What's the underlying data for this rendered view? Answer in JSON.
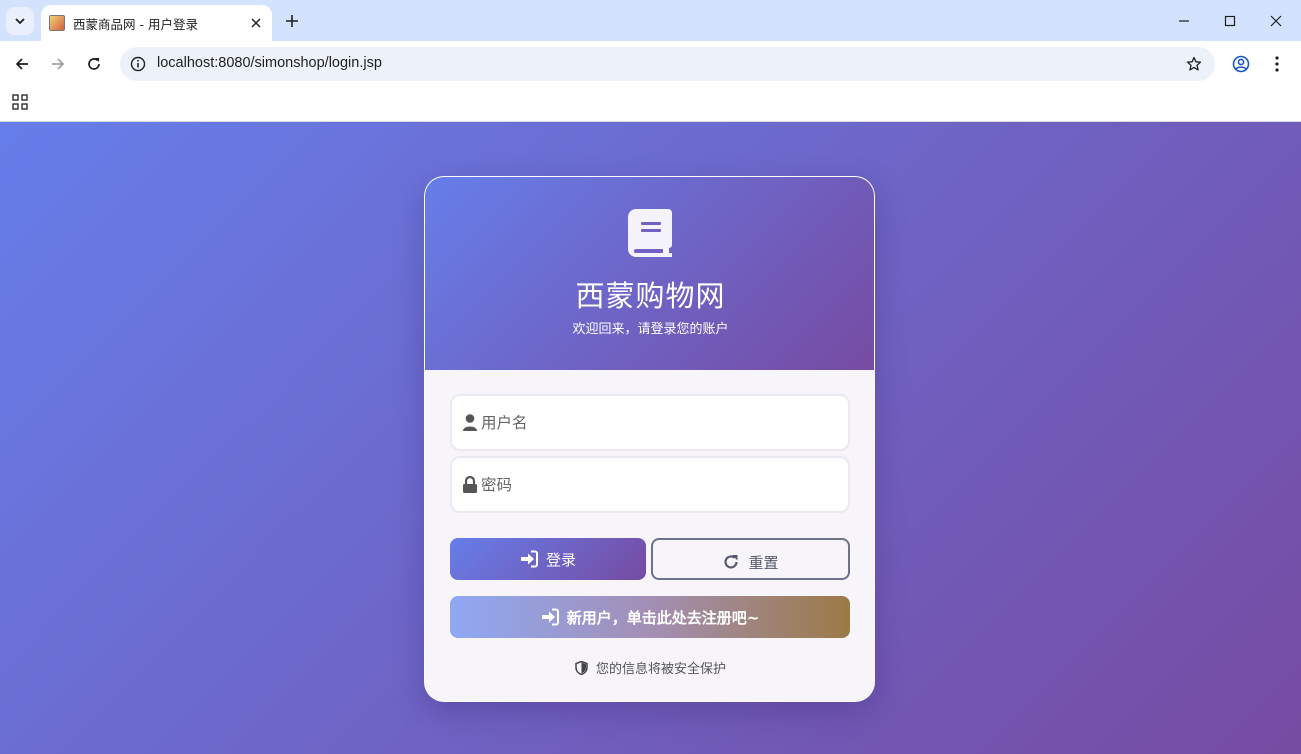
{
  "browser": {
    "tab_title": "西蒙商品网 - 用户登录",
    "url": "localhost:8080/simonshop/login.jsp"
  },
  "header": {
    "icon": "book-icon",
    "brand": "西蒙购物网",
    "welcome": "欢迎回来，请登录您的账户"
  },
  "form": {
    "username_placeholder": "用户名",
    "password_placeholder": "密码",
    "login_label": "登录",
    "reset_label": "重置",
    "register_label": "新用户，单击此处去注册吧~",
    "secure_note": "您的信息将被安全保护"
  },
  "colors": {
    "gradient_start": "#667eea",
    "gradient_end": "#764ba2",
    "card_bg": "#f7f5fa"
  }
}
